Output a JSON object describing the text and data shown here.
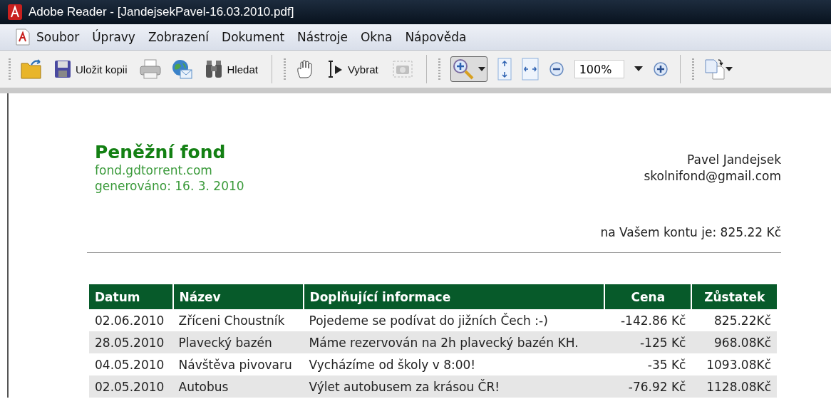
{
  "window": {
    "title": "Adobe Reader - [JandejsekPavel-16.03.2010.pdf]"
  },
  "menu": [
    "Soubor",
    "Úpravy",
    "Zobrazení",
    "Dokument",
    "Nástroje",
    "Okna",
    "Nápověda"
  ],
  "toolbar": {
    "save_copy": "Uložit kopii",
    "find": "Hledat",
    "select": "Vybrat",
    "snapshot_disabled": true,
    "zoom_tool_selected": true,
    "zoom": "100%"
  },
  "document": {
    "title": "Peněžní fond",
    "site": "fond.gdtorrent.com",
    "generated": "generováno: 16. 3. 2010",
    "owner_name": "Pavel Jandejsek",
    "owner_email": "skolnifond@gmail.com",
    "balance": "na Vašem kontu je: 825.22 Kč",
    "table": {
      "columns": [
        "Datum",
        "Název",
        "Doplňující informace",
        "Cena",
        "Zůstatek"
      ],
      "rows": [
        [
          "02.06.2010",
          "Zříceni Choustník",
          "Pojedeme se podívat do jižních Čech :-)",
          "-142.86 Kč",
          "825.22Kč"
        ],
        [
          "28.05.2010",
          "Plavecký bazén",
          "Máme rezervován na 2h plavecký bazén KH.",
          "-125 Kč",
          "968.08Kč"
        ],
        [
          "04.05.2010",
          "Návštěva pivovaru",
          "Vycházíme od školy v 8:00!",
          "-35 Kč",
          "1093.08Kč"
        ],
        [
          "02.05.2010",
          "Autobus",
          "Výlet autobusem za krásou ČR!",
          "-76.92 Kč",
          "1128.08Kč"
        ]
      ]
    }
  }
}
